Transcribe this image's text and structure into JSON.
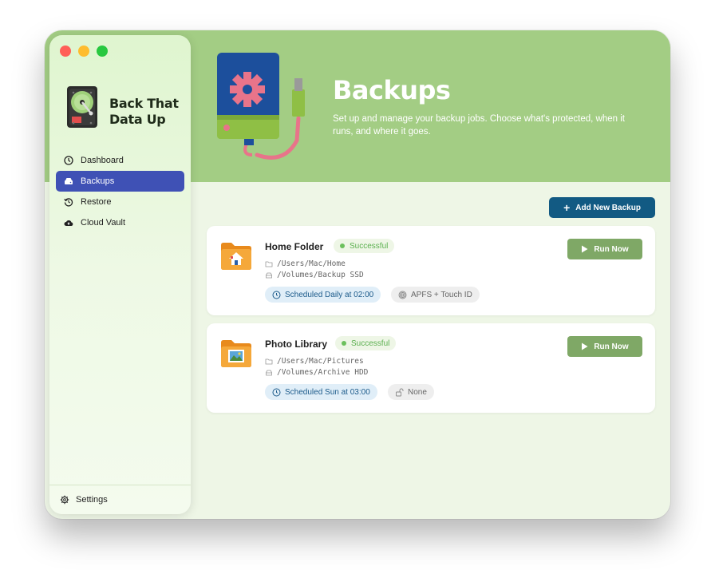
{
  "app": {
    "name": "Back That Data Up",
    "name_line1": "Back That",
    "name_line2": "Data Up"
  },
  "window_controls": [
    "close",
    "minimize",
    "zoom"
  ],
  "sidebar": {
    "items": [
      {
        "label": "Dashboard",
        "icon": "clock-icon",
        "active": false
      },
      {
        "label": "Backups",
        "icon": "drive-icon",
        "active": true
      },
      {
        "label": "Restore",
        "icon": "restore-icon",
        "active": false
      },
      {
        "label": "Cloud Vault",
        "icon": "cloud-icon",
        "active": false
      }
    ],
    "settings_label": "Settings"
  },
  "header": {
    "title": "Backups",
    "subtitle": "Set up and manage your backup jobs. Choose what's protected, when it runs, and where it goes."
  },
  "toolbar": {
    "add_label": "Add New Backup"
  },
  "backups": [
    {
      "name": "Home Folder",
      "status": "Successful",
      "source": "/Users/Mac/Home",
      "destination": "/Volumes/Backup SSD",
      "schedule": "Scheduled Daily at 02:00",
      "security": "APFS + Touch ID",
      "security_icon": "fingerprint-icon",
      "run_label": "Run Now"
    },
    {
      "name": "Photo Library",
      "status": "Successful",
      "source": "/Users/Mac/Pictures",
      "destination": "/Volumes/Archive HDD",
      "schedule": "Scheduled Sun at 03:00",
      "security": "None",
      "security_icon": "unlock-icon",
      "run_label": "Run Now"
    }
  ],
  "colors": {
    "header": "#a3cd84",
    "accent": "#3f51b5",
    "primary_button": "#125a83",
    "run_button": "#7fa866",
    "success": "#5bb04f"
  }
}
